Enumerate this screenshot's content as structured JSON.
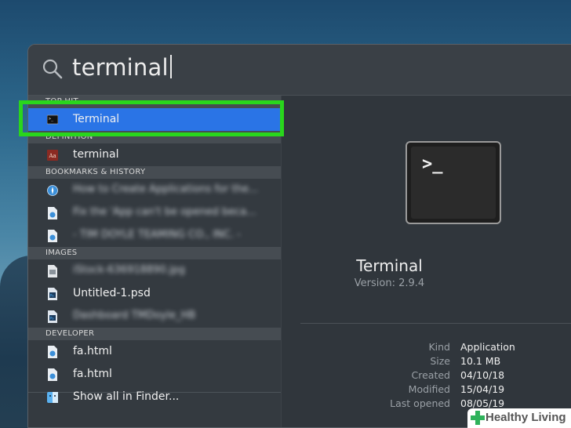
{
  "search": {
    "query": "terminal"
  },
  "sections": {
    "top_hit": "TOP HIT",
    "definition": "DEFINITION",
    "bookmarks": "BOOKMARKS & HISTORY",
    "images": "IMAGES",
    "developer": "DEVELOPER"
  },
  "results": {
    "top_hit": {
      "label": "Terminal"
    },
    "definition": {
      "label": "terminal"
    },
    "bookmarks": [
      {
        "label": "How to Create Applications for the..."
      },
      {
        "label": "Fix the 'App can't be opened beca..."
      },
      {
        "label": "- TIM DOYLE TEAMING CO., INC. -"
      }
    ],
    "images": [
      {
        "label": "iStock-636918890.jpg"
      },
      {
        "label": "Untitled-1.psd"
      },
      {
        "label": "Dashboard TMDoyle_HB"
      }
    ],
    "developer": [
      {
        "label": "fa.html"
      },
      {
        "label": "fa.html"
      }
    ],
    "show_all": "Show all in Finder..."
  },
  "preview": {
    "app_name": "Terminal",
    "version": "Version: 2.9.4",
    "icon_prompt": ">_",
    "meta": [
      {
        "key": "Kind",
        "value": "Application"
      },
      {
        "key": "Size",
        "value": "10.1 MB"
      },
      {
        "key": "Created",
        "value": "04/10/18"
      },
      {
        "key": "Modified",
        "value": "15/04/19"
      },
      {
        "key": "Last opened",
        "value": "08/05/19"
      }
    ]
  },
  "watermark": {
    "text": "Healthy Living"
  },
  "colors": {
    "selection": "#2a74e6",
    "highlight_box": "#29d61c",
    "panel": "#33393f"
  }
}
